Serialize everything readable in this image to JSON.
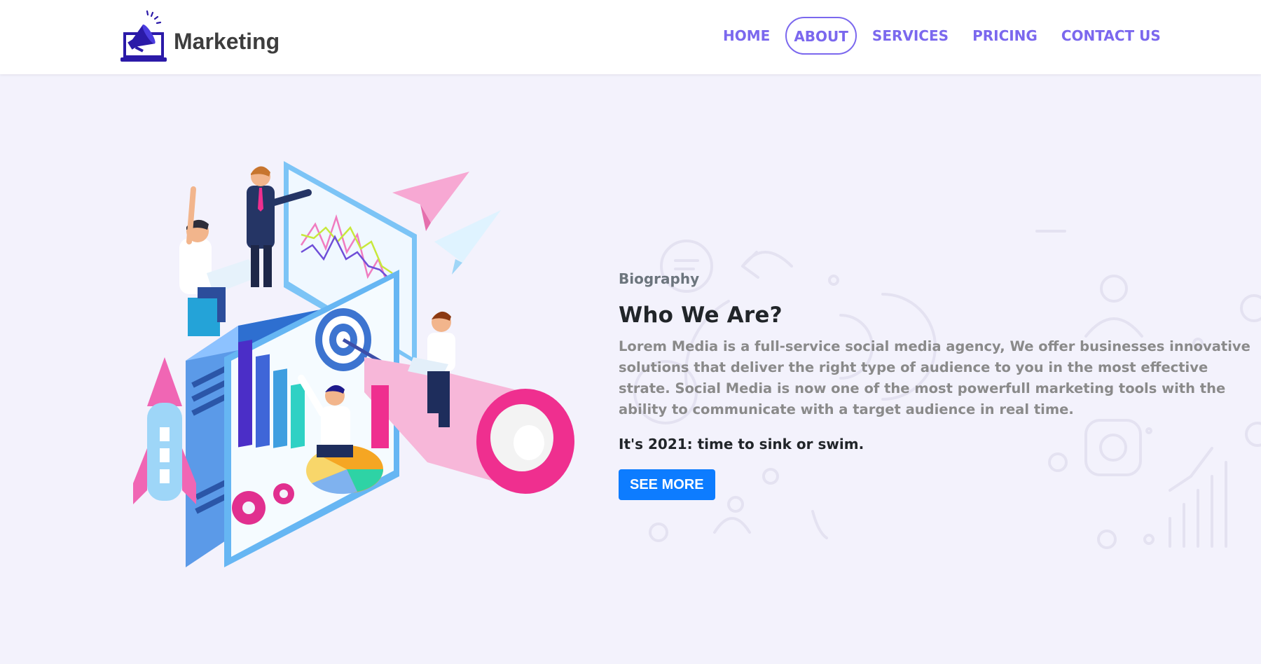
{
  "brand": {
    "name": "Marketing",
    "logo_icon": "megaphone-laptop-icon"
  },
  "nav": {
    "items": [
      {
        "label": "HOME",
        "active": false
      },
      {
        "label": "ABOUT",
        "active": true
      },
      {
        "label": "SERVICES",
        "active": false
      },
      {
        "label": "PRICING",
        "active": false
      },
      {
        "label": "CONTACT US",
        "active": false
      }
    ]
  },
  "hero": {
    "eyebrow": "Biography",
    "headline": "Who We Are?",
    "body": "Lorem Media is a full-service social media agency, We offer businesses innovative solutions that deliver the right type of audience to you in the most effective strate. Social Media is now one of the most powerfull marketing tools with the ability to communicate with a target audience in real time.",
    "tagline": "It's 2021: time to sink or swim.",
    "cta_label": "SEE MORE",
    "illustration_icon": "digital-marketing-illustration-icon"
  },
  "colors": {
    "accent": "#7b68ee",
    "button": "#0d7cff",
    "background": "#f3f2fc",
    "header": "#ffffff"
  }
}
